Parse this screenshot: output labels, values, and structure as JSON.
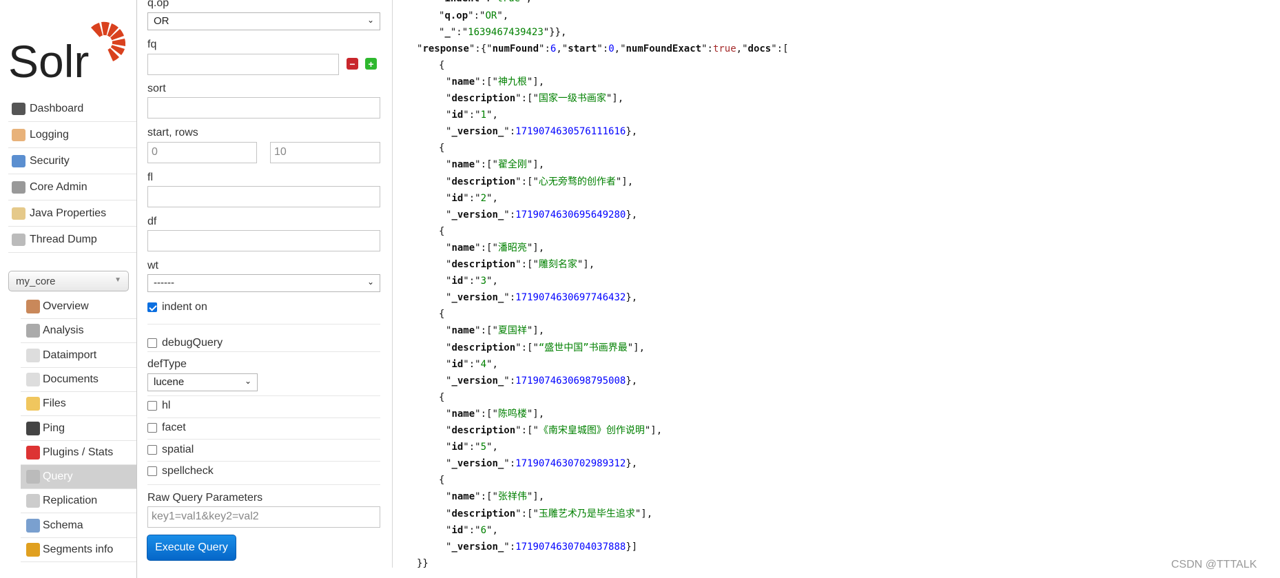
{
  "logo": {
    "text": "Solr",
    "accent": "#d9411e"
  },
  "sidebar": {
    "items": [
      {
        "label": "Dashboard",
        "icon": "dashboard-icon",
        "color": "#555"
      },
      {
        "label": "Logging",
        "icon": "logging-icon",
        "color": "#e8b27a"
      },
      {
        "label": "Security",
        "icon": "security-icon",
        "color": "#5b8fd0"
      },
      {
        "label": "Core Admin",
        "icon": "core-admin-icon",
        "color": "#999"
      },
      {
        "label": "Java Properties",
        "icon": "java-properties-icon",
        "color": "#e5c98a"
      },
      {
        "label": "Thread Dump",
        "icon": "thread-dump-icon",
        "color": "#bbb"
      }
    ],
    "core_selector": "my_core",
    "core_items": [
      {
        "label": "Overview",
        "icon": "house-icon",
        "color": "#c9885a"
      },
      {
        "label": "Analysis",
        "icon": "funnel-icon",
        "color": "#aaa"
      },
      {
        "label": "Dataimport",
        "icon": "dataimport-icon",
        "color": "#ddd"
      },
      {
        "label": "Documents",
        "icon": "documents-icon",
        "color": "#ddd"
      },
      {
        "label": "Files",
        "icon": "folder-icon",
        "color": "#f0c65e"
      },
      {
        "label": "Ping",
        "icon": "ping-icon",
        "color": "#444"
      },
      {
        "label": "Plugins / Stats",
        "icon": "plugins-icon",
        "color": "#d33"
      },
      {
        "label": "Query",
        "icon": "magnifier-icon",
        "color": "#bbb",
        "active": true
      },
      {
        "label": "Replication",
        "icon": "replication-icon",
        "color": "#ccc"
      },
      {
        "label": "Schema",
        "icon": "schema-icon",
        "color": "#7aa0cf"
      },
      {
        "label": "Segments info",
        "icon": "segments-icon",
        "color": "#e0a020"
      }
    ]
  },
  "form": {
    "qop_label": "q.op",
    "qop_value": "OR",
    "fq_label": "fq",
    "fq_value": "",
    "sort_label": "sort",
    "start_rows_label": "start, rows",
    "start_value": "0",
    "rows_value": "10",
    "fl_label": "fl",
    "df_label": "df",
    "wt_label": "wt",
    "wt_value": "------",
    "indent_label": "indent on",
    "indent_checked": true,
    "debugQuery_label": "debugQuery",
    "defType_label": "defType",
    "defType_value": "lucene",
    "hl_label": "hl",
    "facet_label": "facet",
    "spatial_label": "spatial",
    "spellcheck_label": "spellcheck",
    "raw_label": "Raw Query Parameters",
    "raw_placeholder": "key1=val1&key2=val2",
    "execute_label": "Execute Query"
  },
  "response": {
    "header_tail": [
      {
        "key": "indent",
        "value": "true"
      },
      {
        "key": "q.op",
        "value": "OR"
      },
      {
        "key": "_",
        "value": "1639467439423"
      }
    ],
    "numFound": "6",
    "start": "0",
    "numFoundExact": "true",
    "docs": [
      {
        "name": "神九根",
        "description": "国家一级书画家",
        "id": "1",
        "version": "1719074630576111616"
      },
      {
        "name": "翟全刚",
        "description": "心无旁骛的创作者",
        "id": "2",
        "version": "1719074630695649280"
      },
      {
        "name": "潘昭亮",
        "description": "雕刻名家",
        "id": "3",
        "version": "1719074630697746432"
      },
      {
        "name": "夏国祥",
        "description": "“盛世中国”书画界最",
        "id": "4",
        "version": "1719074630698795008"
      },
      {
        "name": "陈鸣楼",
        "description": "《南宋皇城图》创作说明",
        "id": "5",
        "version": "1719074630702989312"
      },
      {
        "name": "张祥伟",
        "description": "玉雕艺术乃是毕生追求",
        "id": "6",
        "version": "1719074630704037888"
      }
    ]
  },
  "watermark": "CSDN @TTTALK",
  "colors": {
    "key": "#111111",
    "string": "#008000",
    "number": "#0000ff",
    "boolean": "#a52a2a",
    "button": "#0a74da"
  }
}
